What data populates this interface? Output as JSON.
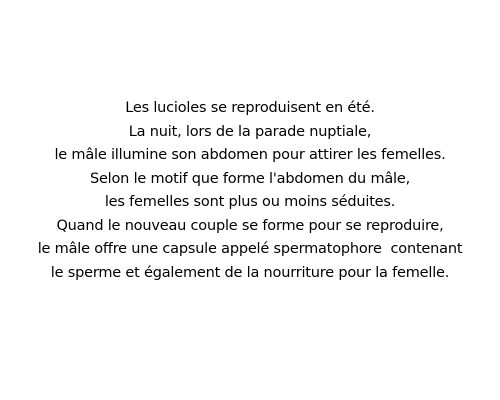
{
  "text": {
    "lines": [
      "Les lucioles se reproduisent en été.",
      "La nuit, lors de la parade nuptiale,",
      "le mâle illumine son abdomen pour attirer les femelles.",
      "Selon le motif que forme l'abdomen du mâle,",
      "les femelles sont plus ou moins séduites.",
      "Quand le nouveau couple se forme pour se reproduire,",
      "le mâle offre une capsule appelé spermatophore  contenant",
      "le sperme et également de la nourriture pour la femelle."
    ]
  },
  "colors": {
    "background": "#ffffff",
    "text": "#000000"
  }
}
